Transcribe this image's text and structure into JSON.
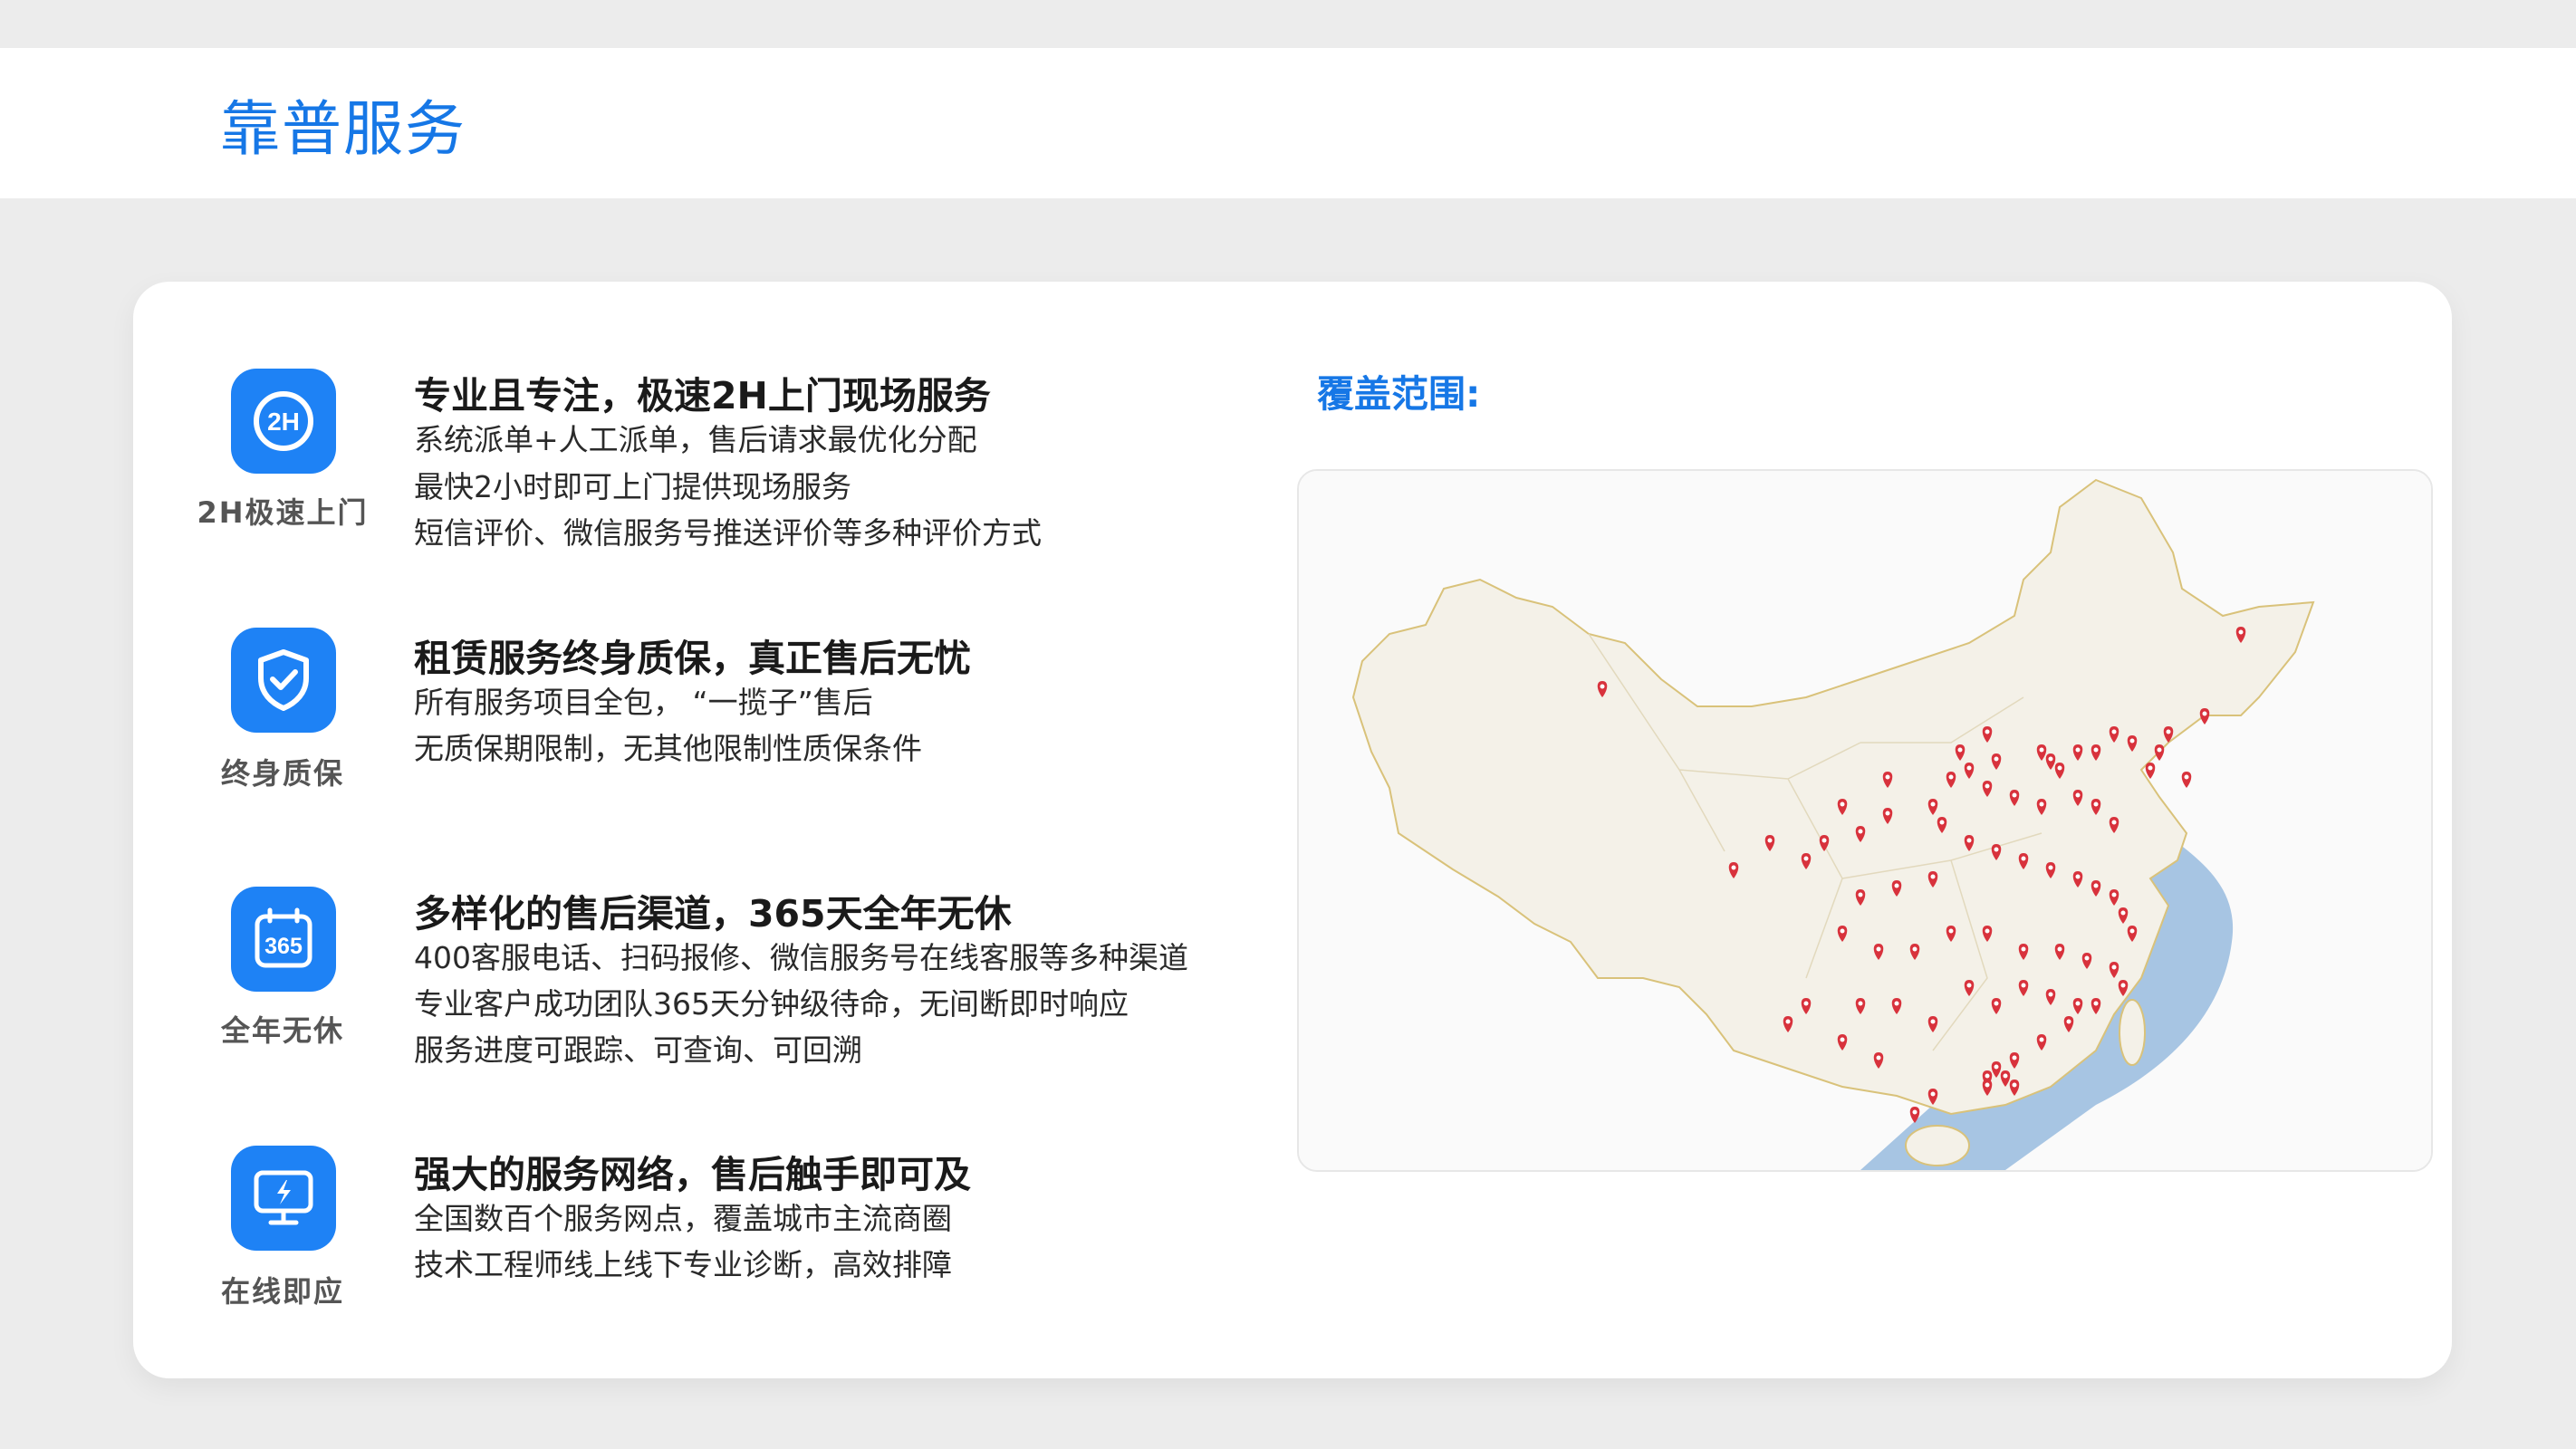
{
  "page_title": "靠普服务",
  "coverage_title": "覆盖范围:",
  "colors": {
    "accent": "#1e82f5",
    "title_blue": "#1677e6",
    "pin_red": "#d8323c",
    "sea_blue": "#a7c5e3",
    "land": "#f4f1e8"
  },
  "features": [
    {
      "icon": "2h-icon",
      "icon_text": "2H",
      "caption": "2H极速上门",
      "heading": "专业且专注，极速2H上门现场服务",
      "lines": [
        "系统派单+人工派单，售后请求最优化分配",
        "最快2小时即可上门提供现场服务",
        "短信评价、微信服务号推送评价等多种评价方式"
      ]
    },
    {
      "icon": "shield-check-icon",
      "caption": "终身质保",
      "heading": "租赁服务终身质保，真正售后无忧",
      "lines": [
        "所有服务项目全包，  “一揽子”售后",
        "无质保期限制，无其他限制性质保条件"
      ]
    },
    {
      "icon": "calendar-365-icon",
      "icon_text": "365",
      "caption": "全年无休",
      "heading": "多样化的售后渠道，365天全年无休",
      "lines": [
        "400客服电话、扫码报修、微信服务号在线客服等多种渠道",
        "专业客户成功团队365天分钟级待命，无间断即时响应",
        "服务进度可跟踪、可查询、可回溯"
      ]
    },
    {
      "icon": "monitor-lightning-icon",
      "caption": "在线即应",
      "heading": "强大的服务网络，售后触手即可及",
      "lines": [
        "全国数百个服务网点，覆盖城市主流商圈",
        "技术工程师线上线下专业诊断，高效排障"
      ]
    }
  ]
}
